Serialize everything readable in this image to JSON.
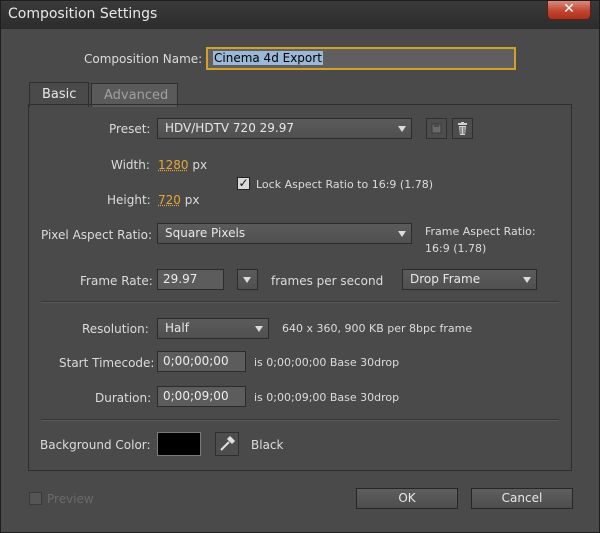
{
  "window": {
    "title": "Composition Settings",
    "close_glyph": "✕"
  },
  "comp_name": {
    "label": "Composition Name:",
    "value": "Cinema 4d Export"
  },
  "tabs": [
    {
      "label": "Basic",
      "active": true
    },
    {
      "label": "Advanced",
      "active": false
    }
  ],
  "preset": {
    "label": "Preset:",
    "value": "HDV/HDTV 720 29.97"
  },
  "width": {
    "label": "Width:",
    "value": "1280",
    "unit": "px"
  },
  "height": {
    "label": "Height:",
    "value": "720",
    "unit": "px"
  },
  "lock_aspect": {
    "label": "Lock Aspect Ratio to 16:9 (1.78)",
    "checked": true
  },
  "pixel_aspect": {
    "label": "Pixel Aspect Ratio:",
    "value": "Square Pixels"
  },
  "frame_aspect": {
    "label": "Frame Aspect Ratio:",
    "value": "16:9 (1.78)"
  },
  "frame_rate": {
    "label": "Frame Rate:",
    "value": "29.97",
    "unit": "frames per second",
    "drop_frame": "Drop Frame"
  },
  "resolution": {
    "label": "Resolution:",
    "value": "Half",
    "info": "640 x 360, 900 KB per 8bpc frame"
  },
  "start_timecode": {
    "label": "Start Timecode:",
    "value": "0;00;00;00",
    "info": "is 0;00;00;00  Base 30drop"
  },
  "duration": {
    "label": "Duration:",
    "value": "0;00;09;00",
    "info": "is 0;00;09;00  Base 30drop"
  },
  "background": {
    "label": "Background Color:",
    "color": "#000000",
    "name": "Black"
  },
  "footer": {
    "preview_label": "Preview",
    "ok_label": "OK",
    "cancel_label": "Cancel"
  },
  "colors": {
    "accent_orange": "#e3a83a",
    "focus_border": "#d3a128",
    "close_red": "#c3442f"
  }
}
